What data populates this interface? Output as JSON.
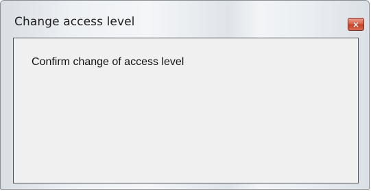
{
  "window": {
    "title": "Change access level",
    "close_glyph": "×"
  },
  "dialog": {
    "message": "Confirm change of access level"
  },
  "icons": {
    "close": "close-icon"
  },
  "colors": {
    "client_background": "#f0f0f0",
    "close_button": "#c5432a"
  }
}
